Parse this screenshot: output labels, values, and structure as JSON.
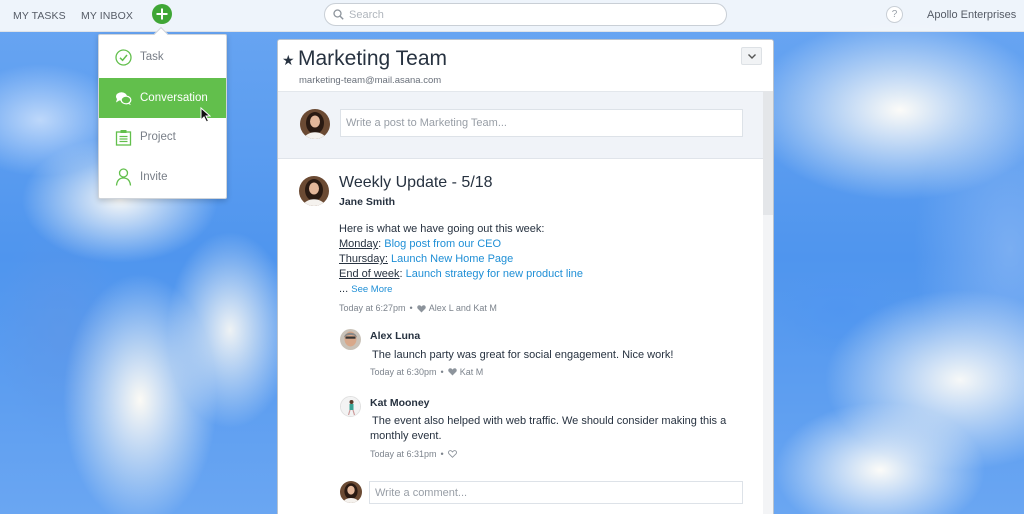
{
  "topbar": {
    "nav": [
      {
        "label": "MY TASKS"
      },
      {
        "label": "MY INBOX"
      }
    ],
    "add_icon": "plus-icon",
    "search": {
      "placeholder": "Search",
      "value": "",
      "icon": "search-icon"
    },
    "help_label": "?",
    "org_name": "Apollo Enterprises",
    "accent_color": "#3fa636"
  },
  "add_menu": {
    "items": [
      {
        "label": "Task",
        "icon": "check-circle-icon",
        "active": false
      },
      {
        "label": "Conversation",
        "icon": "chat-bubbles-icon",
        "active": true
      },
      {
        "label": "Project",
        "icon": "clipboard-icon",
        "active": false
      },
      {
        "label": "Invite",
        "icon": "person-icon",
        "active": false
      }
    ],
    "active_color": "#62bf4c"
  },
  "panel": {
    "title": "Marketing Team",
    "email": "marketing-team@mail.asana.com",
    "starred": true,
    "composer_placeholder": "Write a post to Marketing Team...",
    "post": {
      "title": "Weekly Update - 5/18",
      "author": "Jane Smith",
      "intro": "Here is what we have going out this week:",
      "lines": [
        {
          "label": "Monday",
          "sep": ": ",
          "link": "Blog post from our CEO"
        },
        {
          "label": "Thursday:",
          "sep": " ",
          "link": "Launch New Home Page"
        },
        {
          "label": "End of week",
          "sep": ": ",
          "link": "Launch strategy for new product line"
        }
      ],
      "ellipsis": "...",
      "see_more": "See More",
      "timestamp": "Today at 6:27pm",
      "likes": "Alex L and Kat M"
    },
    "comments": [
      {
        "name": "Alex Luna",
        "text": "The launch party was great for social engagement. Nice work!",
        "timestamp": "Today at 6:30pm",
        "likes": "Kat M",
        "liked": true
      },
      {
        "name": "Kat Mooney",
        "text": "The event also helped with web traffic. We should consider making this a monthly event.",
        "timestamp": "Today at 6:31pm",
        "likes": "",
        "liked": false
      }
    ],
    "comment_placeholder": "Write a comment...",
    "link_color": "#1f8fd6"
  }
}
